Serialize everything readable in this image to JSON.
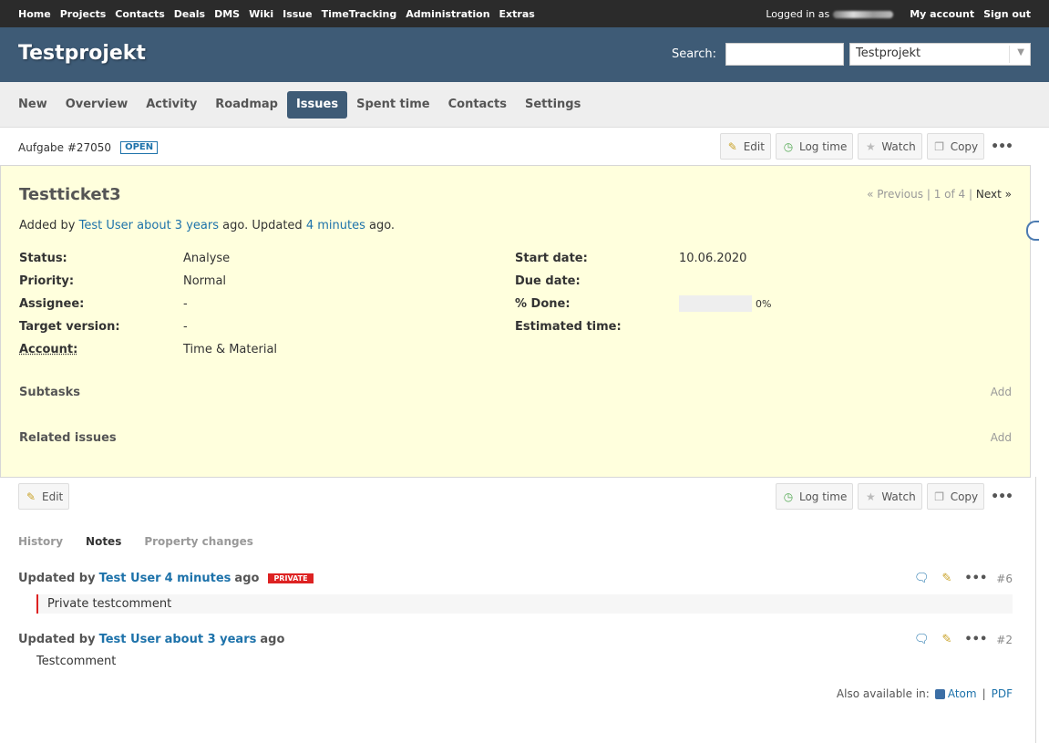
{
  "top_menu": {
    "items": [
      "Home",
      "Projects",
      "Contacts",
      "Deals",
      "DMS",
      "Wiki",
      "Issue",
      "TimeTracking",
      "Administration",
      "Extras"
    ],
    "logged_in_label": "Logged in as",
    "my_account": "My account",
    "sign_out": "Sign out"
  },
  "header": {
    "title": "Testprojekt",
    "search_label": "Search:",
    "project_jump": "Testprojekt"
  },
  "main_menu": {
    "items": [
      "New",
      "Overview",
      "Activity",
      "Roadmap",
      "Issues",
      "Spent time",
      "Contacts",
      "Settings"
    ],
    "selected": "Issues"
  },
  "context": {
    "issue_ref": "Aufgabe #27050",
    "status_badge": "OPEN"
  },
  "buttons": {
    "edit": "Edit",
    "log_time": "Log time",
    "watch": "Watch",
    "copy": "Copy"
  },
  "issue": {
    "subject": "Testticket3",
    "nav_prev": "« Previous",
    "nav_sep1": "|",
    "nav_pos": "1 of 4",
    "nav_sep2": "|",
    "nav_next": "Next »",
    "added_by": "Added by",
    "author": "Test User",
    "created_ago": "about 3 years",
    "ago_updated": "ago. Updated",
    "updated_ago": "4 minutes",
    "ago_end": "ago.",
    "attributes_left": [
      {
        "label": "Status:",
        "value": "Analyse"
      },
      {
        "label": "Priority:",
        "value": "Normal"
      },
      {
        "label": "Assignee:",
        "value": "-"
      },
      {
        "label": "Target version:",
        "value": "-"
      },
      {
        "label": "Account:",
        "value": "Time & Material"
      }
    ],
    "attributes_right": [
      {
        "label": "Start date:",
        "value": "10.06.2020"
      },
      {
        "label": "Due date:",
        "value": ""
      },
      {
        "label": "% Done:",
        "value": "0%"
      },
      {
        "label": "Estimated time:",
        "value": ""
      }
    ],
    "done_ratio": 0,
    "subtasks_label": "Subtasks",
    "related_label": "Related issues",
    "add_label": "Add"
  },
  "tabs": [
    "History",
    "Notes",
    "Property changes"
  ],
  "active_tab": "Notes",
  "journals": [
    {
      "updated_by": "Updated by",
      "user": "Test User",
      "time": "4 minutes",
      "ago": "ago",
      "private": "PRIVATE",
      "number": "#6",
      "note": "Private testcomment"
    },
    {
      "updated_by": "Updated by",
      "user": "Test User",
      "time": "about 3 years",
      "ago": "ago",
      "number": "#2",
      "note": "Testcomment"
    }
  ],
  "other_formats": {
    "label": "Also available in:",
    "atom": "Atom",
    "sep": "|",
    "pdf": "PDF"
  }
}
